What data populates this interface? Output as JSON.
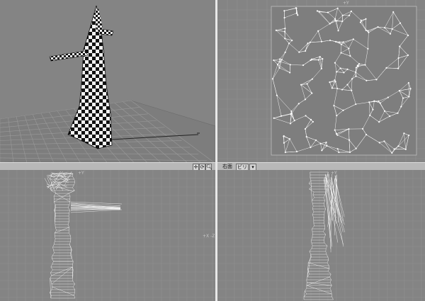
{
  "viewports": {
    "perspective": {
      "name": "perspective-viewport"
    },
    "uv": {
      "name": "uv-map-viewport"
    },
    "front": {
      "name": "front-viewport"
    },
    "side": {
      "name": "right-viewport"
    }
  },
  "toolbar": {
    "view_label": "右面",
    "view_dropdown": "ビリ",
    "dropdown_arrow": "▾",
    "icons": [
      "move-icon",
      "rotate-icon",
      "zoom-icon"
    ]
  },
  "colors": {
    "background": "#848484",
    "grid": "#8f8f8f",
    "wire": "#ffffff",
    "checker_dark": "#111111",
    "checker_light": "#f2f2f2",
    "divider": "#e8e8e8",
    "toolbar": "#b8b8b8"
  },
  "axis_labels": {
    "uv_top": "+Y",
    "front_top": "+Y",
    "front_right": "+X  -Z",
    "side_top": "+Y"
  }
}
